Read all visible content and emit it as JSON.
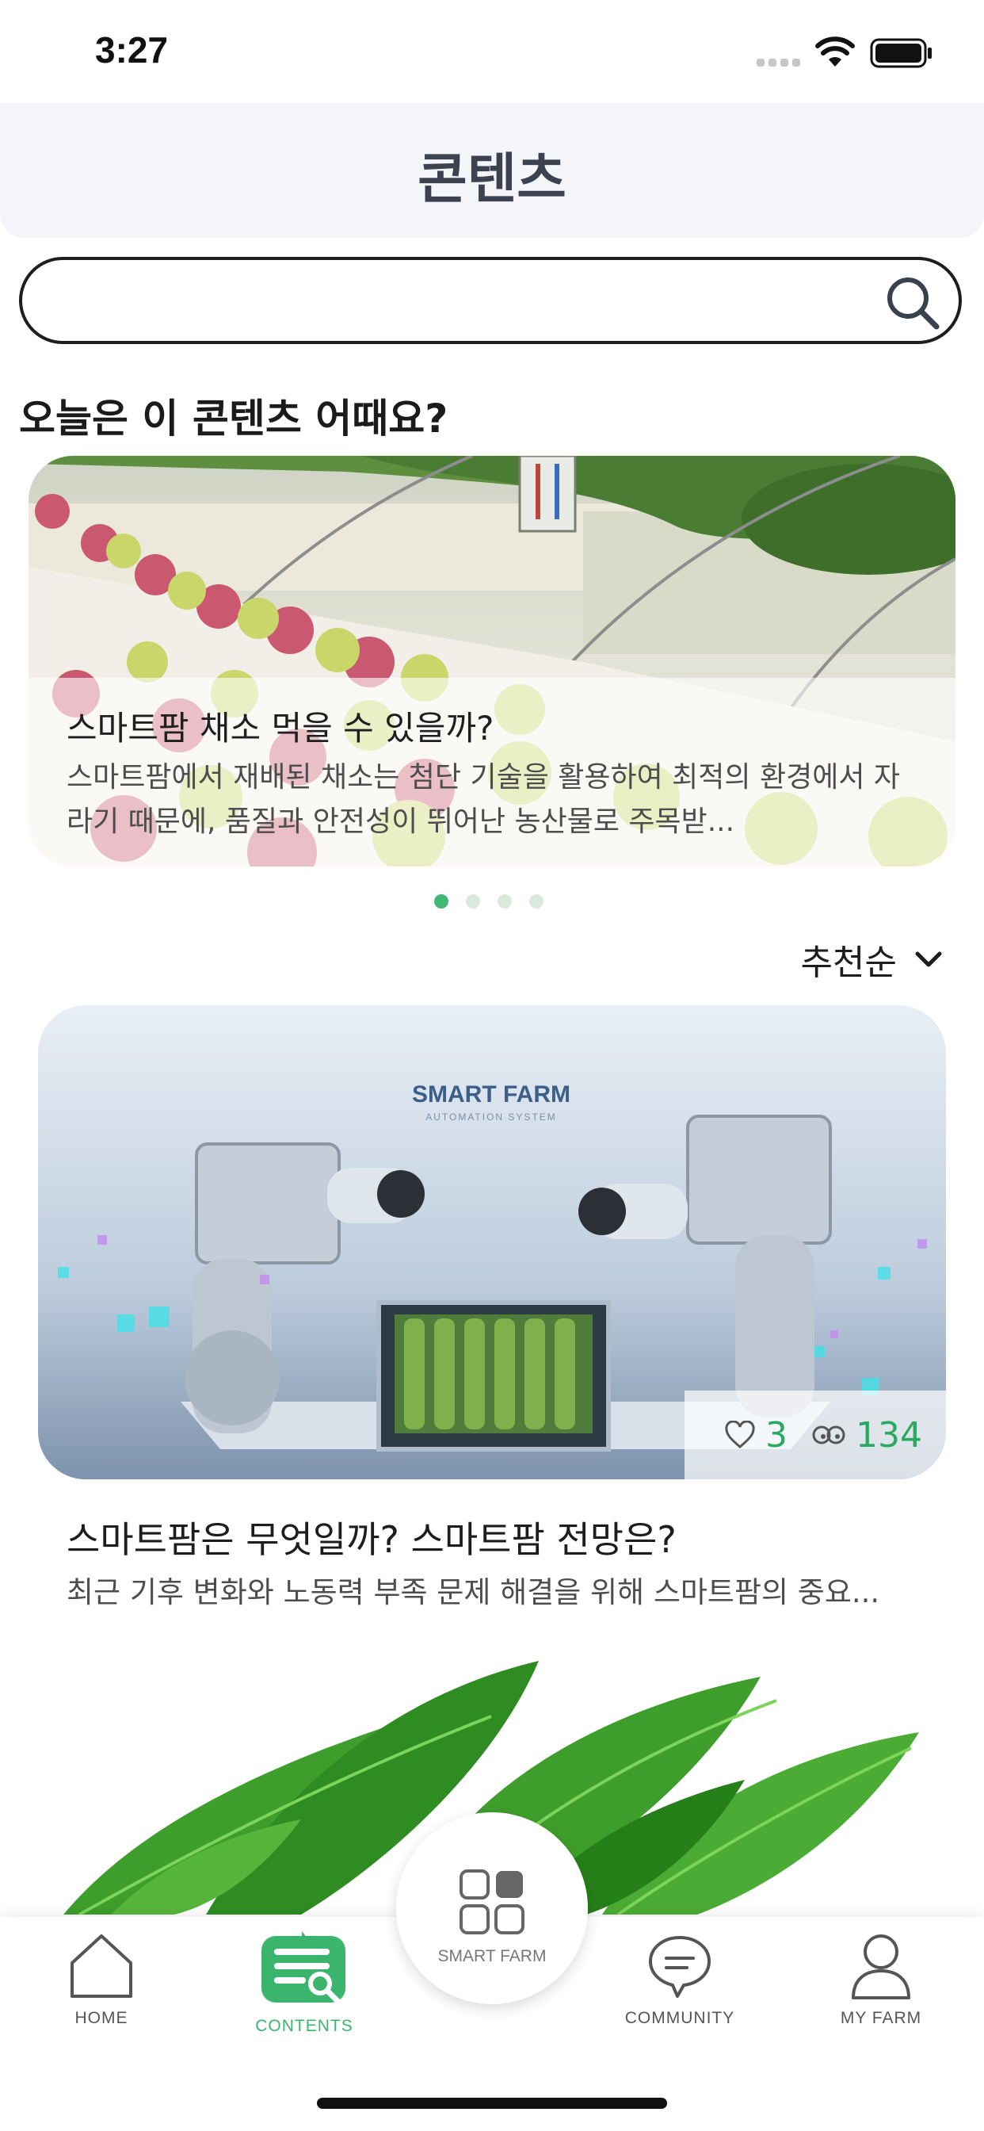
{
  "status_bar": {
    "time": "3:27"
  },
  "header": {
    "title": "콘텐츠"
  },
  "search": {
    "value": "",
    "placeholder": ""
  },
  "section": {
    "title": "오늘은 이 콘텐츠 어때요?"
  },
  "featured": {
    "title": "스마트팜 채소 먹을 수 있을까?",
    "description": "스마트팜에서 재배된 채소는 첨단 기술을 활용하여 최적의 환경에서 자라기 때문에, 품질과 안전성이 뛰어난 농산물로 주목받...",
    "pagination": {
      "total": 4,
      "current": 1
    }
  },
  "sort": {
    "label": "추천순"
  },
  "articles": [
    {
      "image_text": {
        "title": "SMART FARM",
        "subtitle": "AUTOMATION SYSTEM"
      },
      "likes": "3",
      "views": "134",
      "title": "스마트팜은 무엇일까? 스마트팜 전망은?",
      "description": "최근 기후 변화와 노동력 부족 문제 해결을 위해 스마트팜의 중요..."
    }
  ],
  "tabbar": {
    "items": [
      {
        "label": "HOME",
        "icon": "home-icon"
      },
      {
        "label": "CONTENTS",
        "icon": "contents-icon"
      },
      {
        "label": "SMART FARM",
        "icon": "grid-icon"
      },
      {
        "label": "COMMUNITY",
        "icon": "chat-bubble-icon"
      },
      {
        "label": "MY FARM",
        "icon": "person-icon"
      }
    ],
    "active": "CONTENTS"
  },
  "colors": {
    "accent": "#41b873",
    "header_bg": "#f4f5f9",
    "title": "#3d4250"
  }
}
